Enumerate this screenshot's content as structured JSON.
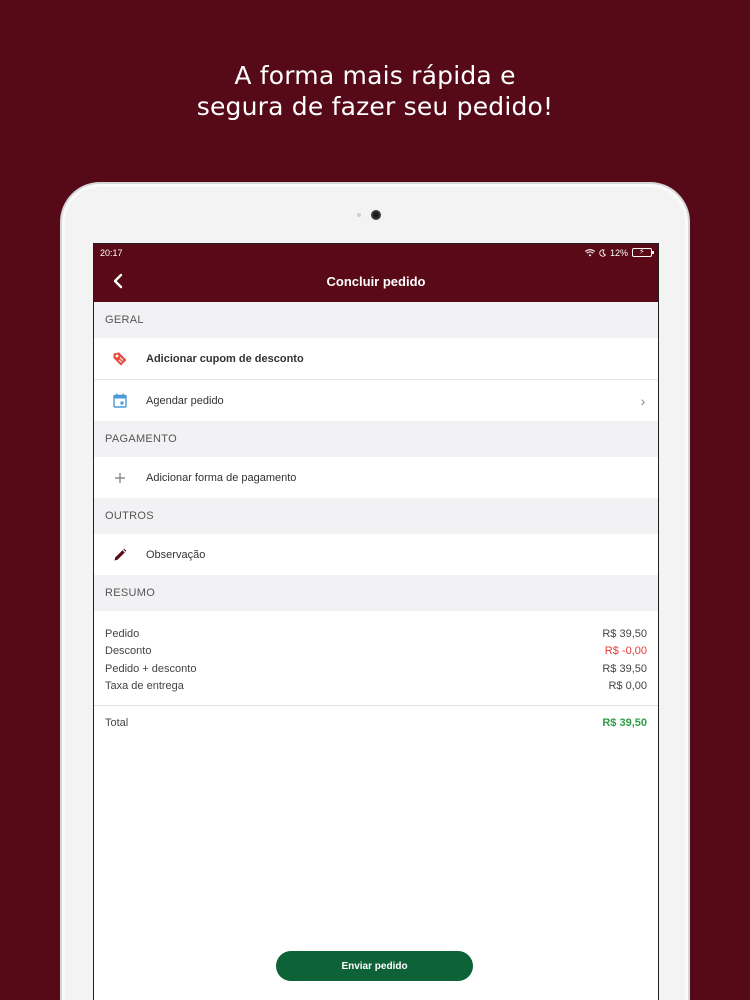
{
  "headline": {
    "line1": "A forma mais rápida e",
    "line2": "segura de fazer seu pedido!"
  },
  "status_bar": {
    "time": "20:17",
    "battery": "12%"
  },
  "nav": {
    "title": "Concluir pedido"
  },
  "sections": {
    "geral": "GERAL",
    "pagamento": "PAGAMENTO",
    "outros": "OUTROS",
    "resumo": "RESUMO"
  },
  "rows": {
    "cupom": "Adicionar cupom de desconto",
    "agendar": "Agendar pedido",
    "pagamento": "Adicionar forma de pagamento",
    "observacao": "Observação"
  },
  "summary": {
    "pedido_label": "Pedido",
    "pedido_value": "R$ 39,50",
    "desconto_label": "Desconto",
    "desconto_value": "R$ -0,00",
    "pedido_desconto_label": "Pedido + desconto",
    "pedido_desconto_value": "R$ 39,50",
    "taxa_label": "Taxa de entrega",
    "taxa_value": "R$ 0,00",
    "total_label": "Total",
    "total_value": "R$ 39,50"
  },
  "actions": {
    "send": "Enviar pedido"
  },
  "colors": {
    "brand": "#560a18",
    "primary_button": "#0e6237",
    "negative": "#e53935",
    "positive": "#2e9f46"
  },
  "icons": {
    "cupom": "tag-icon",
    "agendar": "calendar-icon",
    "pagamento": "plus-icon",
    "observacao": "pencil-icon"
  }
}
